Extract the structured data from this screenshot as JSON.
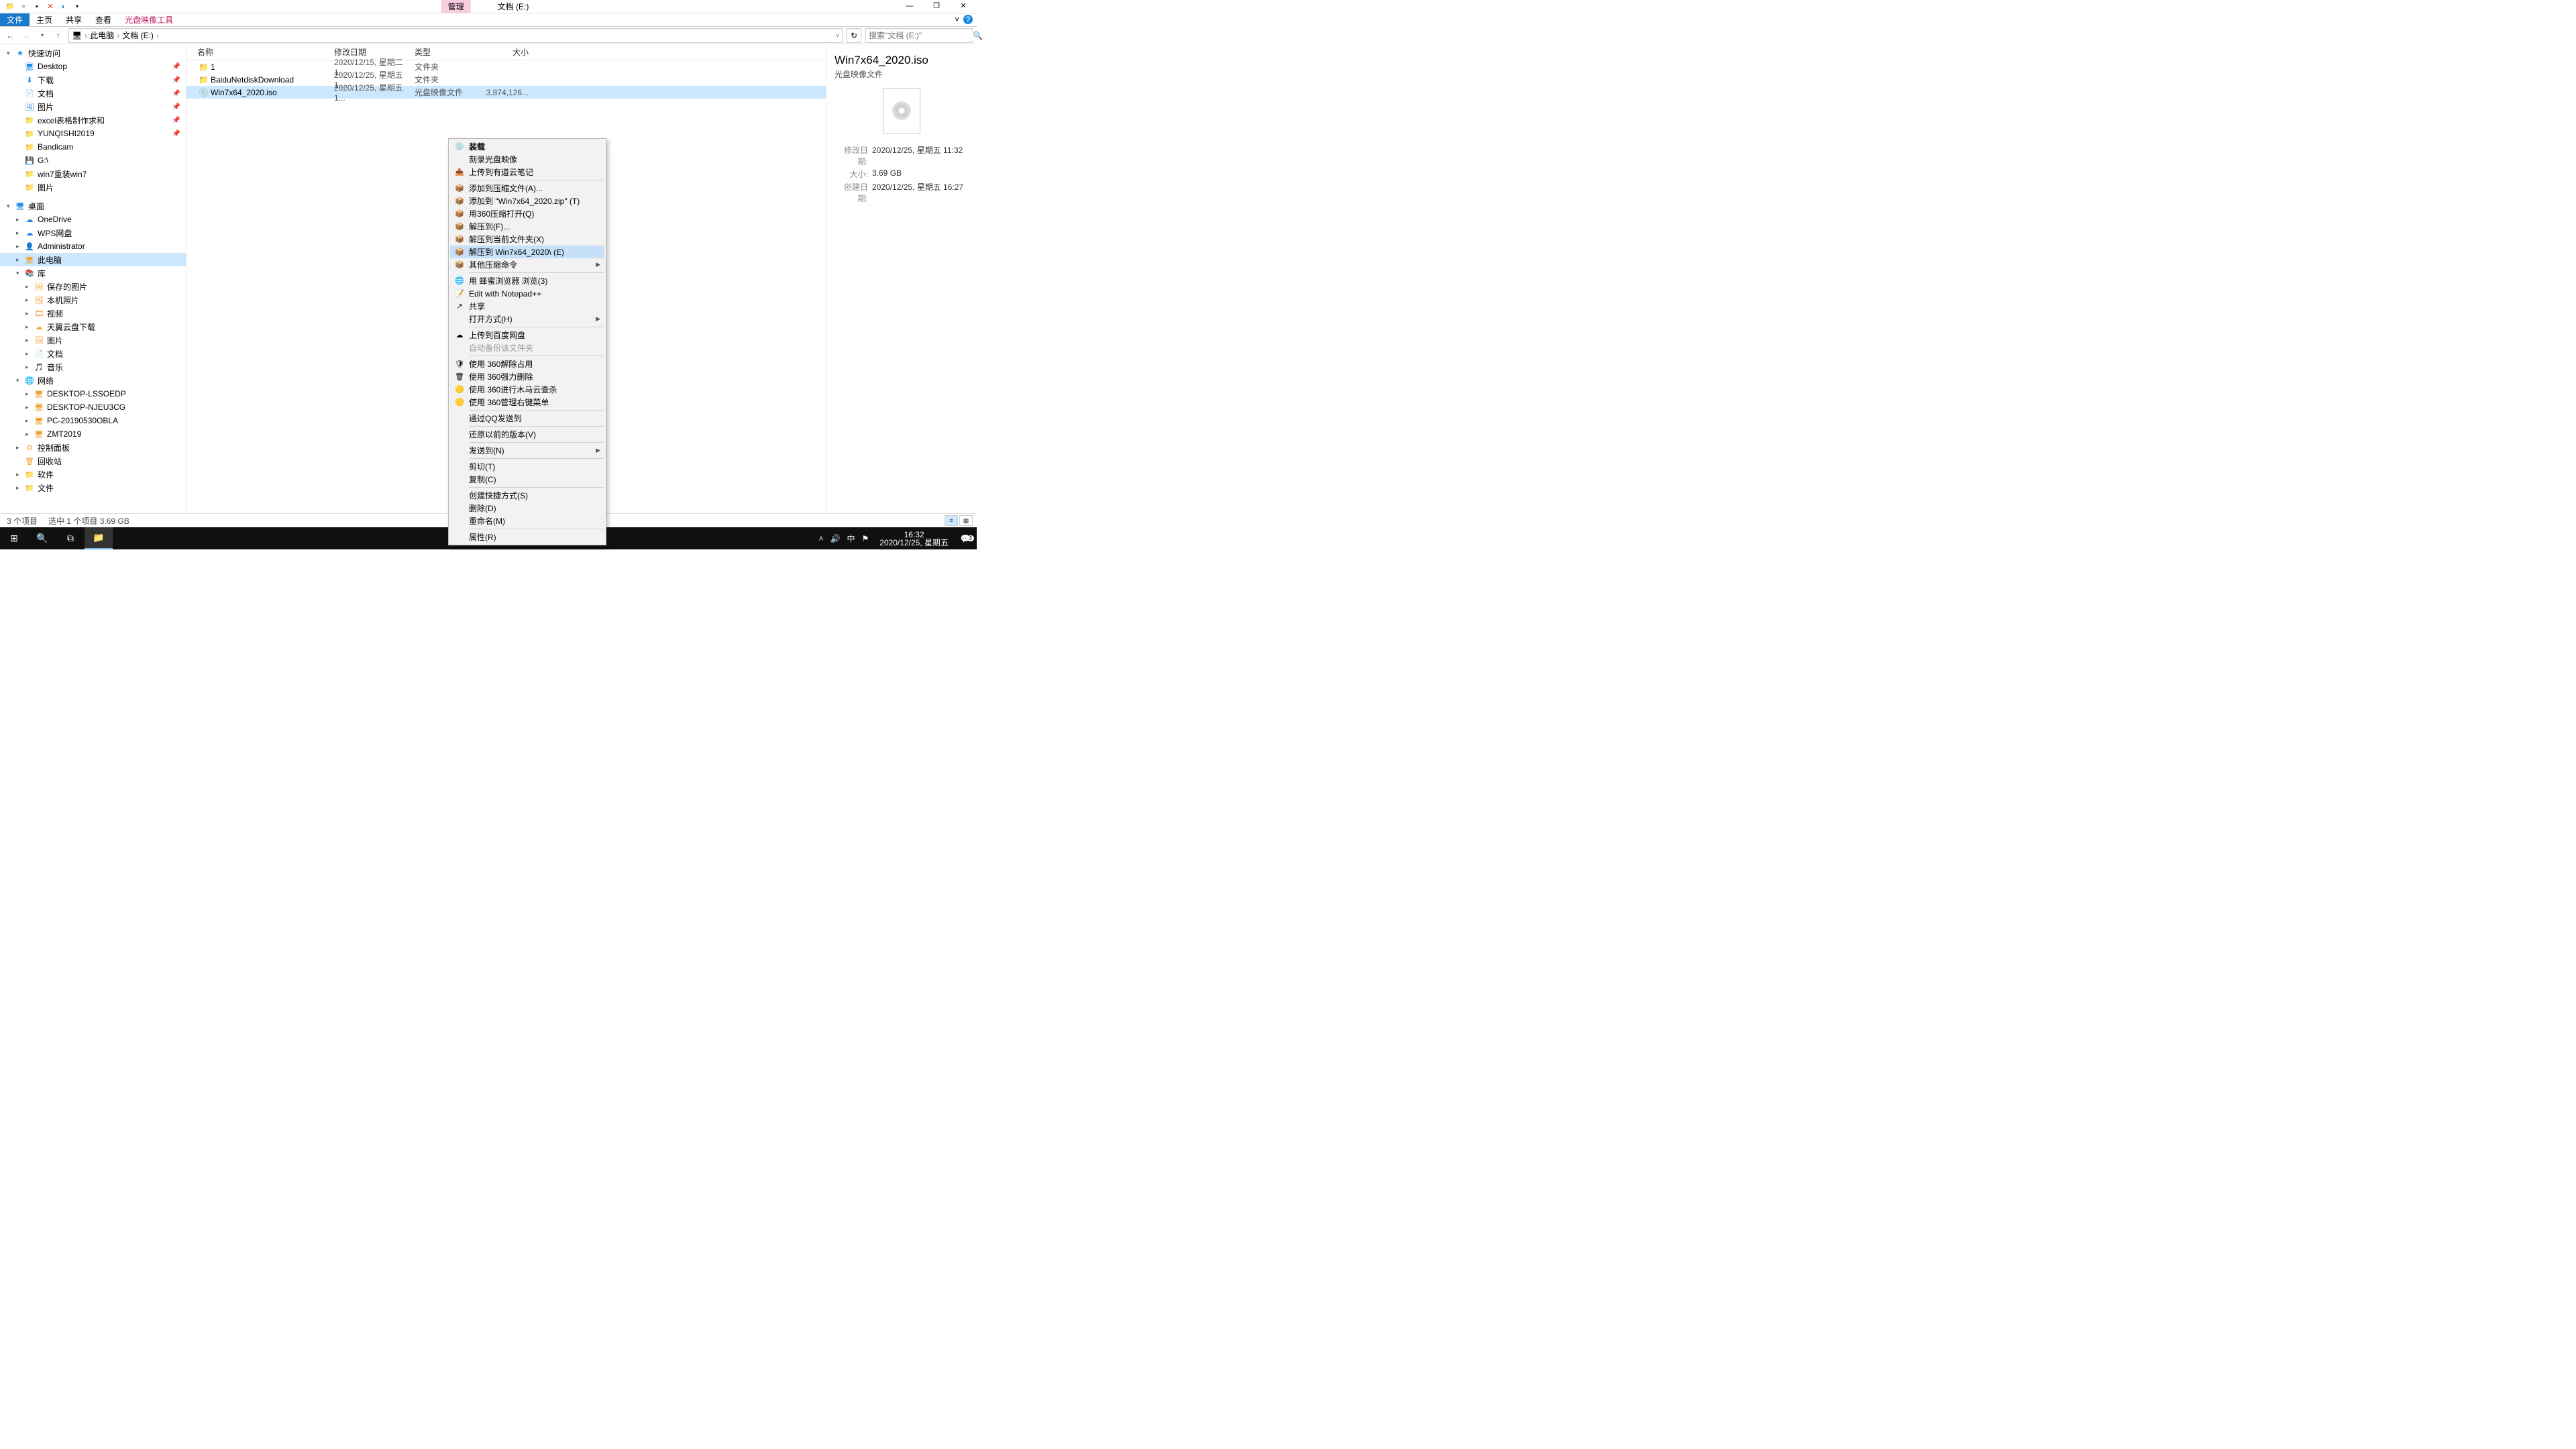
{
  "window": {
    "title_tab": "管理",
    "title_loc": "文档 (E:)"
  },
  "ribbon": {
    "file": "文件",
    "home": "主页",
    "share": "共享",
    "view": "查看",
    "tool": "光盘映像工具"
  },
  "crumbs": {
    "root": "此电脑",
    "cur": "文档 (E:)"
  },
  "search": {
    "placeholder": "搜索\"文档 (E:)\""
  },
  "cols": {
    "name": "名称",
    "date": "修改日期",
    "type": "类型",
    "size": "大小"
  },
  "rows": [
    {
      "icon": "📁",
      "name": "1",
      "date": "2020/12/15, 星期二 1...",
      "type": "文件夹",
      "size": ""
    },
    {
      "icon": "📁",
      "name": "BaiduNetdiskDownload",
      "date": "2020/12/25, 星期五 1...",
      "type": "文件夹",
      "size": ""
    },
    {
      "icon": "💿",
      "name": "Win7x64_2020.iso",
      "date": "2020/12/25, 星期五 1...",
      "type": "光盘映像文件",
      "size": "3,874,126..."
    }
  ],
  "tree": [
    {
      "ind": 0,
      "exp": "▾",
      "ico": "★",
      "txt": "快速访问",
      "c": "#1e88e5"
    },
    {
      "ind": 1,
      "ico": "🖥",
      "txt": "Desktop",
      "pin": true,
      "c": "#1e88e5"
    },
    {
      "ind": 1,
      "ico": "⬇",
      "txt": "下载",
      "pin": true,
      "c": "#1e88e5"
    },
    {
      "ind": 1,
      "ico": "📄",
      "txt": "文档",
      "pin": true,
      "c": "#1e88e5"
    },
    {
      "ind": 1,
      "ico": "🖼",
      "txt": "图片",
      "pin": true,
      "c": "#1e88e5"
    },
    {
      "ind": 1,
      "ico": "📁",
      "txt": "excel表格制作求和",
      "pin": true
    },
    {
      "ind": 1,
      "ico": "📁",
      "txt": "YUNQISHI2019",
      "pin": true
    },
    {
      "ind": 1,
      "ico": "📁",
      "txt": "Bandicam"
    },
    {
      "ind": 1,
      "ico": "💾",
      "txt": "G:\\"
    },
    {
      "ind": 1,
      "ico": "📁",
      "txt": "win7重装win7"
    },
    {
      "ind": 1,
      "ico": "📁",
      "txt": "图片"
    },
    {
      "ind": 0,
      "spacer": true
    },
    {
      "ind": 0,
      "exp": "▾",
      "ico": "🖥",
      "txt": "桌面",
      "c": "#1e88e5"
    },
    {
      "ind": 1,
      "exp": "▸",
      "ico": "☁",
      "txt": "OneDrive",
      "c": "#1e88e5"
    },
    {
      "ind": 1,
      "exp": "▸",
      "ico": "☁",
      "txt": "WPS网盘",
      "c": "#1e88e5"
    },
    {
      "ind": 1,
      "exp": "▸",
      "ico": "👤",
      "txt": "Administrator"
    },
    {
      "ind": 1,
      "exp": "▸",
      "ico": "🖥",
      "txt": "此电脑",
      "sel": true
    },
    {
      "ind": 1,
      "exp": "▾",
      "ico": "📚",
      "txt": "库"
    },
    {
      "ind": 2,
      "exp": "▸",
      "ico": "🖼",
      "txt": "保存的图片"
    },
    {
      "ind": 2,
      "exp": "▸",
      "ico": "🖼",
      "txt": "本机照片"
    },
    {
      "ind": 2,
      "exp": "▸",
      "ico": "🎞",
      "txt": "视频"
    },
    {
      "ind": 2,
      "exp": "▸",
      "ico": "☁",
      "txt": "天翼云盘下载"
    },
    {
      "ind": 2,
      "exp": "▸",
      "ico": "🖼",
      "txt": "图片"
    },
    {
      "ind": 2,
      "exp": "▸",
      "ico": "📄",
      "txt": "文档"
    },
    {
      "ind": 2,
      "exp": "▸",
      "ico": "🎵",
      "txt": "音乐"
    },
    {
      "ind": 1,
      "exp": "▾",
      "ico": "🌐",
      "txt": "网络"
    },
    {
      "ind": 2,
      "exp": "▸",
      "ico": "🖥",
      "txt": "DESKTOP-LSSOEDP"
    },
    {
      "ind": 2,
      "exp": "▸",
      "ico": "🖥",
      "txt": "DESKTOP-NJEU3CG"
    },
    {
      "ind": 2,
      "exp": "▸",
      "ico": "🖥",
      "txt": "PC-20190530OBLA"
    },
    {
      "ind": 2,
      "exp": "▸",
      "ico": "🖥",
      "txt": "ZMT2019"
    },
    {
      "ind": 1,
      "exp": "▸",
      "ico": "⚙",
      "txt": "控制面板"
    },
    {
      "ind": 1,
      "ico": "🗑",
      "txt": "回收站"
    },
    {
      "ind": 1,
      "exp": "▸",
      "ico": "📁",
      "txt": "软件"
    },
    {
      "ind": 1,
      "exp": "▸",
      "ico": "📁",
      "txt": "文件"
    }
  ],
  "menu": [
    {
      "ico": "💿",
      "txt": "装载",
      "bold": true
    },
    {
      "txt": "刻录光盘映像"
    },
    {
      "ico": "📤",
      "txt": "上传到有道云笔记"
    },
    {
      "sep": true
    },
    {
      "ico": "📦",
      "txt": "添加到压缩文件(A)..."
    },
    {
      "ico": "📦",
      "txt": "添加到 \"Win7x64_2020.zip\" (T)"
    },
    {
      "ico": "📦",
      "txt": "用360压缩打开(Q)"
    },
    {
      "ico": "📦",
      "txt": "解压到(F)..."
    },
    {
      "ico": "📦",
      "txt": "解压到当前文件夹(X)"
    },
    {
      "ico": "📦",
      "txt": "解压到 Win7x64_2020\\ (E)",
      "hover": true
    },
    {
      "ico": "📦",
      "txt": "其他压缩命令",
      "arrow": true
    },
    {
      "sep": true
    },
    {
      "ico": "🌐",
      "txt": "用 蜂蜜浏览器 浏览(3)"
    },
    {
      "ico": "📝",
      "txt": "Edit with Notepad++"
    },
    {
      "ico": "↗",
      "txt": "共享"
    },
    {
      "txt": "打开方式(H)",
      "arrow": true
    },
    {
      "sep": true
    },
    {
      "ico": "☁",
      "txt": "上传到百度网盘"
    },
    {
      "txt": "自动备份该文件夹",
      "disabled": true
    },
    {
      "sep": true
    },
    {
      "ico": "🛡",
      "txt": "使用 360解除占用"
    },
    {
      "ico": "🗑",
      "txt": "使用 360强力删除"
    },
    {
      "ico": "🟡",
      "txt": "使用 360进行木马云查杀"
    },
    {
      "ico": "🟡",
      "txt": "使用 360管理右键菜单"
    },
    {
      "sep": true
    },
    {
      "txt": "通过QQ发送到"
    },
    {
      "sep": true
    },
    {
      "txt": "还原以前的版本(V)"
    },
    {
      "sep": true
    },
    {
      "txt": "发送到(N)",
      "arrow": true
    },
    {
      "sep": true
    },
    {
      "txt": "剪切(T)"
    },
    {
      "txt": "复制(C)"
    },
    {
      "sep": true
    },
    {
      "txt": "创建快捷方式(S)"
    },
    {
      "txt": "删除(D)"
    },
    {
      "txt": "重命名(M)"
    },
    {
      "sep": true
    },
    {
      "txt": "属性(R)"
    }
  ],
  "details": {
    "title": "Win7x64_2020.iso",
    "sub": "光盘映像文件",
    "rows": [
      {
        "k": "修改日期:",
        "v": "2020/12/25, 星期五 11:32"
      },
      {
        "k": "大小:",
        "v": "3.69 GB"
      },
      {
        "k": "创建日期:",
        "v": "2020/12/25, 星期五 16:27"
      }
    ]
  },
  "status": {
    "count": "3 个项目",
    "sel": "选中 1 个项目  3.69 GB"
  },
  "taskbar": {
    "ime": "中",
    "time": "16:32",
    "date": "2020/12/25, 星期五",
    "notif": "3"
  }
}
